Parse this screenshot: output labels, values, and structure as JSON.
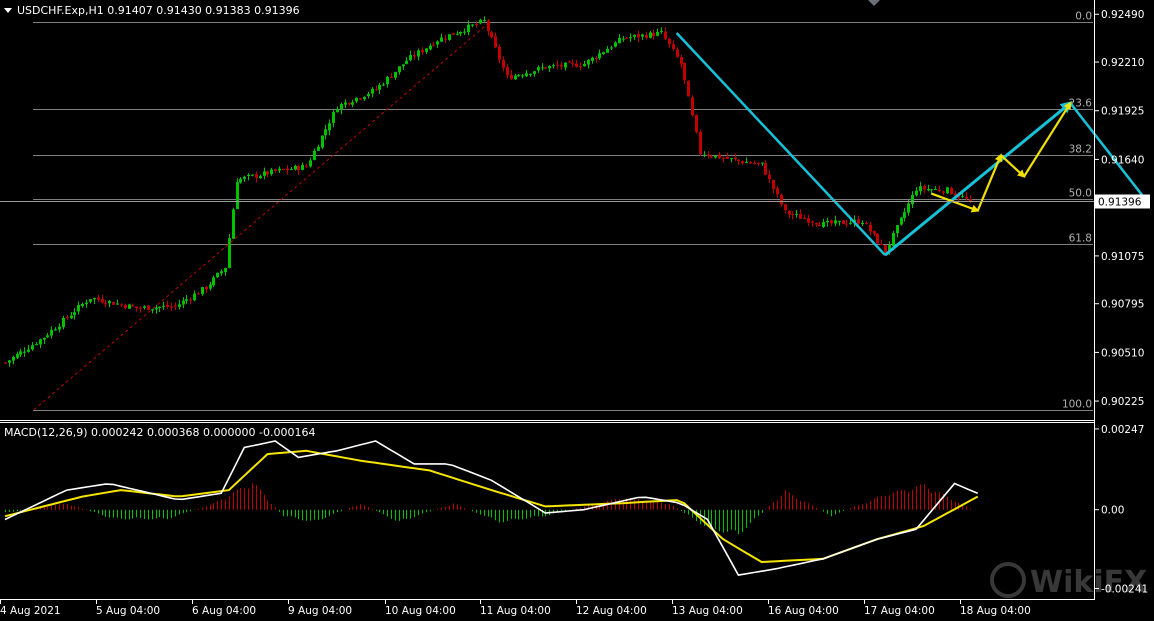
{
  "header": {
    "symbol_line": "USDCHF.Exp,H1  0.91407 0.91430 0.91383 0.91396"
  },
  "indicator": {
    "label": "MACD(12,26,9) 0.000242 0.000368 0.000000 -0.000164"
  },
  "current_price_label": "0.91396",
  "watermark": "WikiFX",
  "colors": {
    "bull_candle": "#00c000",
    "bear_candle": "#c00000",
    "macd_line": "#ffffff",
    "signal_line": "#f5e500",
    "trend_line": "#17c2d8",
    "forecast_arrow": "#f0e000",
    "fib_line": "#7f7f7f"
  },
  "chart_data": [
    {
      "type": "candlestick",
      "symbol": "USDCHF.Exp",
      "timeframe": "H1",
      "ohlc_last": {
        "open": 0.91407,
        "high": 0.9143,
        "low": 0.91383,
        "close": 0.91396
      },
      "ylim": [
        0.9012,
        0.9255
      ],
      "y_ticks": [
        {
          "value": 0.9249,
          "label": "0.92490"
        },
        {
          "value": 0.9221,
          "label": "0.92210"
        },
        {
          "value": 0.91925,
          "label": "0.91925"
        },
        {
          "value": 0.9164,
          "label": "0.91640"
        },
        {
          "value": 0.91075,
          "label": "0.91075"
        },
        {
          "value": 0.90795,
          "label": "0.90795"
        },
        {
          "value": 0.9051,
          "label": "0.90510"
        },
        {
          "value": 0.90225,
          "label": "0.90225"
        }
      ],
      "x_ticks": [
        "4 Aug 2021",
        "5 Aug 04:00",
        "6 Aug 04:00",
        "9 Aug 04:00",
        "10 Aug 04:00",
        "11 Aug 04:00",
        "12 Aug 04:00",
        "13 Aug 04:00",
        "16 Aug 04:00",
        "17 Aug 04:00",
        "18 Aug 04:00"
      ],
      "fibonacci_levels": [
        {
          "label": "0.0",
          "price": 0.92445
        },
        {
          "label": "23.6",
          "price": 0.91935
        },
        {
          "label": "38.2",
          "price": 0.91665
        },
        {
          "label": "50.0",
          "price": 0.9141
        },
        {
          "label": "61.8",
          "price": 0.91145
        },
        {
          "label": "100.0",
          "price": 0.90175
        }
      ],
      "close_path": [
        {
          "bar": 0,
          "close": 0.9045
        },
        {
          "bar": 10,
          "close": 0.906
        },
        {
          "bar": 22,
          "close": 0.9083
        },
        {
          "bar": 34,
          "close": 0.9077
        },
        {
          "bar": 44,
          "close": 0.9078
        },
        {
          "bar": 52,
          "close": 0.9089
        },
        {
          "bar": 57,
          "close": 0.9101
        },
        {
          "bar": 60,
          "close": 0.9152
        },
        {
          "bar": 70,
          "close": 0.9157
        },
        {
          "bar": 78,
          "close": 0.916
        },
        {
          "bar": 86,
          "close": 0.9195
        },
        {
          "bar": 96,
          "close": 0.9205
        },
        {
          "bar": 104,
          "close": 0.9222
        },
        {
          "bar": 112,
          "close": 0.9234
        },
        {
          "bar": 124,
          "close": 0.9245
        },
        {
          "bar": 130,
          "close": 0.9212
        },
        {
          "bar": 140,
          "close": 0.9218
        },
        {
          "bar": 150,
          "close": 0.922
        },
        {
          "bar": 160,
          "close": 0.9235
        },
        {
          "bar": 170,
          "close": 0.9238
        },
        {
          "bar": 175,
          "close": 0.922
        },
        {
          "bar": 180,
          "close": 0.9168
        },
        {
          "bar": 190,
          "close": 0.9163
        },
        {
          "bar": 196,
          "close": 0.9161
        },
        {
          "bar": 202,
          "close": 0.9133
        },
        {
          "bar": 212,
          "close": 0.9126
        },
        {
          "bar": 222,
          "close": 0.9128
        },
        {
          "bar": 228,
          "close": 0.911
        },
        {
          "bar": 236,
          "close": 0.9147
        },
        {
          "bar": 244,
          "close": 0.9146
        },
        {
          "bar": 250,
          "close": 0.91396
        }
      ],
      "annotations": [
        {
          "type": "trend_line",
          "from": {
            "bar": 174,
            "price": 0.9238
          },
          "to": {
            "bar": 228,
            "price": 0.9108
          }
        },
        {
          "type": "trend_line",
          "from": {
            "bar": 228,
            "price": 0.9108
          },
          "to": {
            "bar": 276,
            "price": 0.9197
          }
        },
        {
          "type": "trend_line",
          "from": {
            "bar": 276,
            "price": 0.9197
          },
          "to": {
            "bar": 296,
            "price": 0.9139
          }
        },
        {
          "type": "forecast_arrow",
          "points": [
            {
              "bar": 240,
              "price": 0.9144
            },
            {
              "bar": 252,
              "price": 0.9134
            },
            {
              "bar": 258,
              "price": 0.91665
            },
            {
              "bar": 264,
              "price": 0.9154
            },
            {
              "bar": 276,
              "price": 0.9197
            }
          ]
        }
      ]
    },
    {
      "type": "line",
      "name": "MACD(12,26,9)",
      "ylim": [
        -0.0027,
        0.00262
      ],
      "y_ticks": [
        {
          "value": 0.00247,
          "label": "0.00247"
        },
        {
          "value": 0.0,
          "label": "0.00"
        },
        {
          "value": -0.00241,
          "label": "-0.00241"
        }
      ],
      "series": [
        {
          "name": "MACD",
          "points": [
            {
              "bar": 0,
              "value": -0.0003
            },
            {
              "bar": 16,
              "value": 0.0006
            },
            {
              "bar": 27,
              "value": 0.0008
            },
            {
              "bar": 45,
              "value": 0.0003
            },
            {
              "bar": 56,
              "value": 0.0005
            },
            {
              "bar": 62,
              "value": 0.0019
            },
            {
              "bar": 70,
              "value": 0.0021
            },
            {
              "bar": 76,
              "value": 0.0016
            },
            {
              "bar": 86,
              "value": 0.0018
            },
            {
              "bar": 96,
              "value": 0.0021
            },
            {
              "bar": 106,
              "value": 0.0014
            },
            {
              "bar": 115,
              "value": 0.0014
            },
            {
              "bar": 126,
              "value": 0.0009
            },
            {
              "bar": 140,
              "value": -0.0001
            },
            {
              "bar": 150,
              "value": 0.0
            },
            {
              "bar": 165,
              "value": 0.0004
            },
            {
              "bar": 175,
              "value": 0.0002
            },
            {
              "bar": 182,
              "value": -0.0003
            },
            {
              "bar": 190,
              "value": -0.002
            },
            {
              "bar": 200,
              "value": -0.0018
            },
            {
              "bar": 212,
              "value": -0.0015
            },
            {
              "bar": 226,
              "value": -0.0009
            },
            {
              "bar": 236,
              "value": -0.0006
            },
            {
              "bar": 246,
              "value": 0.0008
            },
            {
              "bar": 252,
              "value": 0.0005
            }
          ]
        },
        {
          "name": "Signal",
          "points": [
            {
              "bar": 0,
              "value": -0.0002
            },
            {
              "bar": 20,
              "value": 0.0004
            },
            {
              "bar": 30,
              "value": 0.0006
            },
            {
              "bar": 45,
              "value": 0.0004
            },
            {
              "bar": 58,
              "value": 0.0006
            },
            {
              "bar": 68,
              "value": 0.0017
            },
            {
              "bar": 78,
              "value": 0.0018
            },
            {
              "bar": 92,
              "value": 0.0015
            },
            {
              "bar": 110,
              "value": 0.0012
            },
            {
              "bar": 126,
              "value": 0.0006
            },
            {
              "bar": 140,
              "value": 0.0001
            },
            {
              "bar": 160,
              "value": 0.0002
            },
            {
              "bar": 175,
              "value": 0.0003
            },
            {
              "bar": 186,
              "value": -0.0009
            },
            {
              "bar": 196,
              "value": -0.0016
            },
            {
              "bar": 212,
              "value": -0.0015
            },
            {
              "bar": 226,
              "value": -0.0009
            },
            {
              "bar": 238,
              "value": -0.0005
            },
            {
              "bar": 252,
              "value": 0.0004
            }
          ]
        },
        {
          "name": "Histogram",
          "points": [
            {
              "bar": 0,
              "value": -0.0001
            },
            {
              "bar": 16,
              "value": 0.0002
            },
            {
              "bar": 28,
              "value": -0.0003
            },
            {
              "bar": 42,
              "value": -0.0003
            },
            {
              "bar": 54,
              "value": 0.0002
            },
            {
              "bar": 64,
              "value": 0.0009
            },
            {
              "bar": 72,
              "value": -0.0002
            },
            {
              "bar": 80,
              "value": -0.0004
            },
            {
              "bar": 92,
              "value": 0.0002
            },
            {
              "bar": 102,
              "value": -0.0004
            },
            {
              "bar": 116,
              "value": 0.0002
            },
            {
              "bar": 128,
              "value": -0.0004
            },
            {
              "bar": 140,
              "value": -0.0002
            },
            {
              "bar": 160,
              "value": 0.0004
            },
            {
              "bar": 172,
              "value": 0.0002
            },
            {
              "bar": 182,
              "value": -0.0006
            },
            {
              "bar": 190,
              "value": -0.0008
            },
            {
              "bar": 202,
              "value": 0.0006
            },
            {
              "bar": 214,
              "value": -0.0002
            },
            {
              "bar": 228,
              "value": 0.0005
            },
            {
              "bar": 238,
              "value": 0.0008
            },
            {
              "bar": 246,
              "value": 0.0003
            },
            {
              "bar": 252,
              "value": -0.0001
            }
          ]
        }
      ]
    }
  ]
}
